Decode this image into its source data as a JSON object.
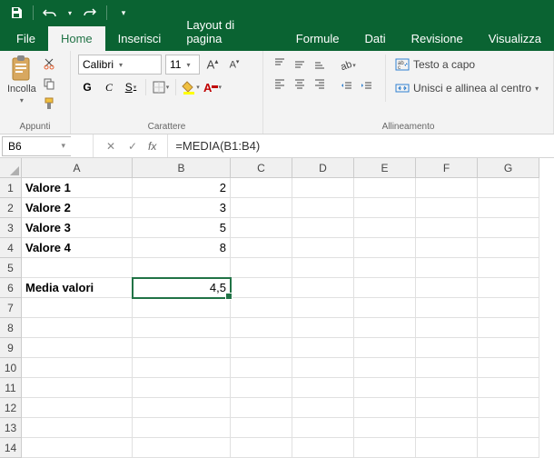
{
  "qat": {
    "save": "save",
    "undo": "undo",
    "redo": "redo"
  },
  "tabs": [
    "File",
    "Home",
    "Inserisci",
    "Layout di pagina",
    "Formule",
    "Dati",
    "Revisione",
    "Visualizza"
  ],
  "active_tab": 1,
  "ribbon": {
    "clipboard": {
      "paste": "Incolla",
      "group_label": "Appunti"
    },
    "font": {
      "name": "Calibri",
      "size": "11",
      "bold": "G",
      "italic": "C",
      "underline": "S",
      "group_label": "Carattere"
    },
    "alignment": {
      "wrap": "Testo a capo",
      "merge": "Unisci e allinea al centro",
      "group_label": "Allineamento"
    }
  },
  "namebox": "B6",
  "fx_label": "fx",
  "formula": "=MEDIA(B1:B4)",
  "columns": [
    "A",
    "B",
    "C",
    "D",
    "E",
    "F",
    "G"
  ],
  "rows": [
    1,
    2,
    3,
    4,
    5,
    6,
    7,
    8,
    9,
    10,
    11,
    12,
    13,
    14
  ],
  "cells": {
    "A1": "Valore 1",
    "B1": "2",
    "A2": "Valore 2",
    "B2": "3",
    "A3": "Valore 3",
    "B3": "5",
    "A4": "Valore 4",
    "B4": "8",
    "A6": "Media valori",
    "B6": "4,5"
  },
  "selected_cell": "B6",
  "colors": {
    "accent": "#217346",
    "titlebar": "#0a6332"
  }
}
